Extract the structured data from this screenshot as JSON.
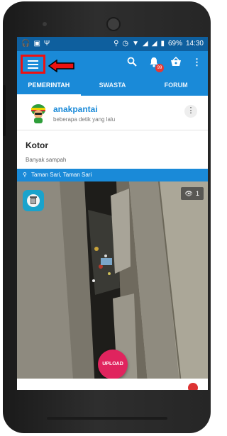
{
  "status_bar": {
    "battery": "69%",
    "time": "14:30"
  },
  "tabs": [
    {
      "label": "PEMERINTAH",
      "active": true
    },
    {
      "label": "SWASTA",
      "active": false
    },
    {
      "label": "FORUM",
      "active": false
    }
  ],
  "toolbar": {
    "notification_badge": "99"
  },
  "post": {
    "username": "anakpantai",
    "time": "beberapa detik yang lalu",
    "title": "Kotor",
    "description": "Banyak sampah",
    "location": "Taman Sari, Taman Sari",
    "view_count": "1"
  },
  "upload_button": {
    "label": "UPLOAD"
  },
  "colors": {
    "app_bar": "#1a8ad8",
    "status_bar": "#0e5f9e",
    "upload_button": "#e0245e",
    "highlight_box": "#ee1111"
  }
}
